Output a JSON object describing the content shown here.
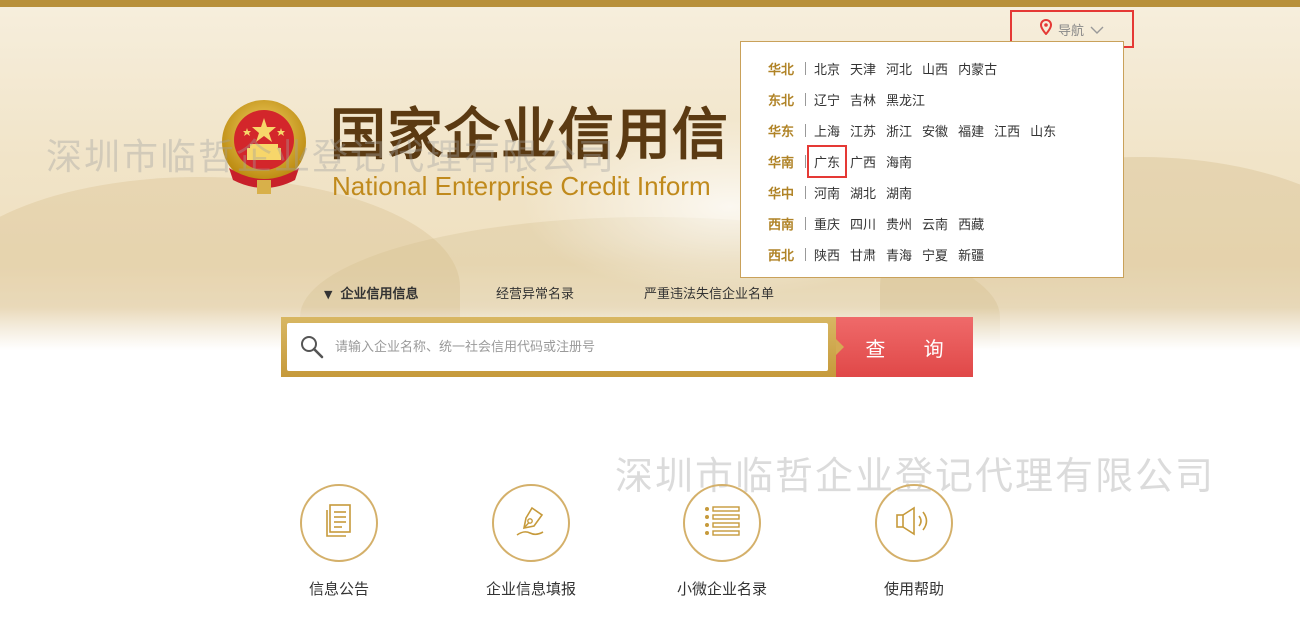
{
  "header": {
    "nav_label": "导航",
    "brand_title": "国家企业信用信",
    "brand_subtitle": "National Enterprise Credit Inform"
  },
  "watermark_text": "深圳市临哲企业登记代理有限公司",
  "nav_panel": {
    "regions": [
      {
        "name": "华北",
        "provinces": [
          "北京",
          "天津",
          "河北",
          "山西",
          "内蒙古"
        ]
      },
      {
        "name": "东北",
        "provinces": [
          "辽宁",
          "吉林",
          "黑龙江"
        ]
      },
      {
        "name": "华东",
        "provinces": [
          "上海",
          "江苏",
          "浙江",
          "安徽",
          "福建",
          "江西",
          "山东"
        ]
      },
      {
        "name": "华南",
        "provinces": [
          "广东",
          "广西",
          "海南"
        ]
      },
      {
        "name": "华中",
        "provinces": [
          "河南",
          "湖北",
          "湖南"
        ]
      },
      {
        "name": "西南",
        "provinces": [
          "重庆",
          "四川",
          "贵州",
          "云南",
          "西藏"
        ]
      },
      {
        "name": "西北",
        "provinces": [
          "陕西",
          "甘肃",
          "青海",
          "宁夏",
          "新疆"
        ]
      }
    ],
    "highlighted": "广东"
  },
  "search": {
    "tabs": [
      "企业信用信息",
      "经营异常名录",
      "严重违法失信企业名单"
    ],
    "placeholder": "请输入企业名称、统一社会信用代码或注册号",
    "button_label": "查 询"
  },
  "features": [
    {
      "label": "信息公告",
      "icon": "document-icon"
    },
    {
      "label": "企业信息填报",
      "icon": "pen-icon"
    },
    {
      "label": "小微企业名录",
      "icon": "list-icon"
    },
    {
      "label": "使用帮助",
      "icon": "speaker-icon"
    }
  ],
  "colors": {
    "gold": "#c69a3b",
    "brown_title": "#5b3a12",
    "accent_red": "#e04848",
    "highlight_red": "#e53935"
  }
}
